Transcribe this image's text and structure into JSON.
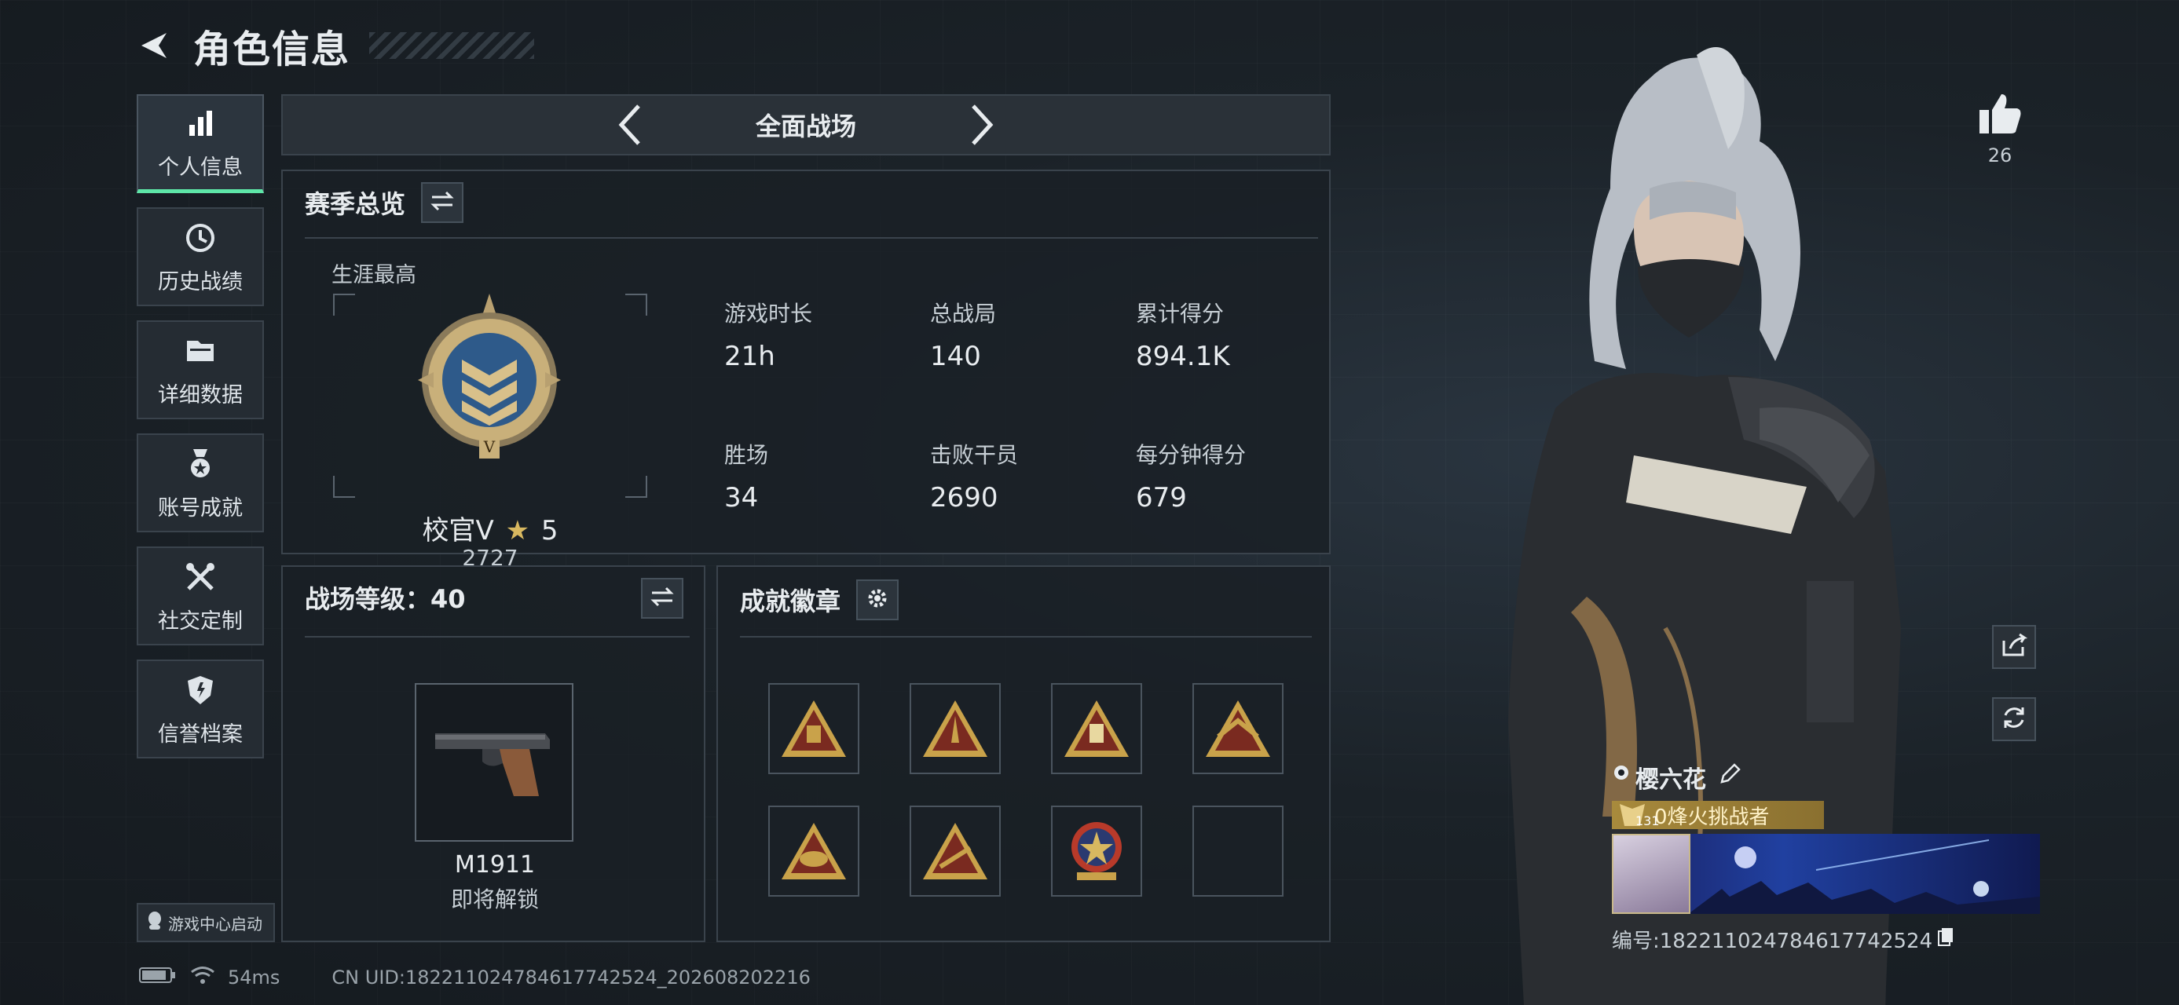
{
  "header": {
    "title": "角色信息"
  },
  "nav": [
    {
      "label": "个人信息",
      "icon": "bar-chart-icon",
      "active": true
    },
    {
      "label": "历史战绩",
      "icon": "history-icon",
      "active": false
    },
    {
      "label": "详细数据",
      "icon": "folder-icon",
      "active": false
    },
    {
      "label": "账号成就",
      "icon": "medal-icon",
      "active": false
    },
    {
      "label": "社交定制",
      "icon": "tools-icon",
      "active": false
    },
    {
      "label": "信誉档案",
      "icon": "shield-icon",
      "active": false
    }
  ],
  "nav_bottom": {
    "label": "游戏中心启动",
    "icon": "tencent-icon"
  },
  "mode": {
    "title": "全面战场"
  },
  "season": {
    "title": "赛季总览",
    "career_label": "生涯最高",
    "rank_name": "校官V",
    "rank_stars": "5",
    "rank_score": "2727",
    "stats": [
      {
        "label": "游戏时长",
        "value": "21h"
      },
      {
        "label": "总战局",
        "value": "140"
      },
      {
        "label": "累计得分",
        "value": "894.1K"
      },
      {
        "label": "胜场",
        "value": "34"
      },
      {
        "label": "击败干员",
        "value": "2690"
      },
      {
        "label": "每分钟得分",
        "value": "679"
      }
    ]
  },
  "level": {
    "title": "战场等级：40",
    "weapon_name": "M1911",
    "weapon_status": "即将解锁"
  },
  "achievements": {
    "title": "成就徽章",
    "medals": [
      "medal-1",
      "medal-2",
      "medal-3",
      "medal-4",
      "medal-5",
      "medal-6",
      "medal-7",
      "empty-slot"
    ]
  },
  "footer": {
    "ping": "54ms",
    "uid": "CN UID:18221102478461774252​4_202608202216"
  },
  "profile": {
    "likes": "26",
    "player_name": "樱六花",
    "level_badge": "131",
    "player_title": "0烽火挑战者",
    "player_id": "编号:18221102478461774252​4"
  },
  "colors": {
    "accent_green": "#5ee6a8",
    "gold": "#c9a24a",
    "panel_border": "#3a434c"
  }
}
